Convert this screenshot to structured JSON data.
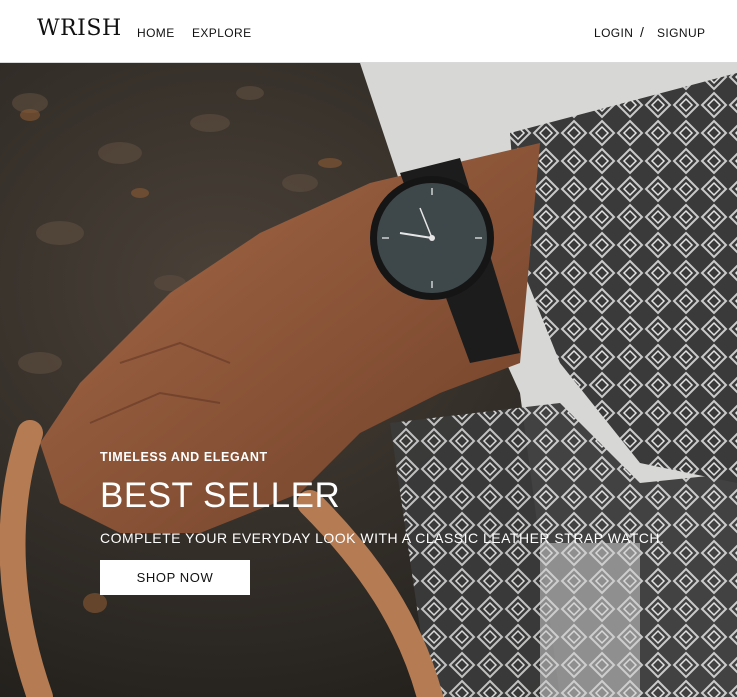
{
  "nav": {
    "logo": "WRISH",
    "links": [
      {
        "label": "HOME"
      },
      {
        "label": "EXPLORE"
      }
    ],
    "login": "LOGIN",
    "separator": "/",
    "signup": "SIGNUP"
  },
  "hero": {
    "eyebrow": "TIMELESS AND ELEGANT",
    "headline": "BEST SELLER",
    "subline": "COMPLETE YOUR EVERYDAY LOOK WITH A CLASSIC LEATHER STRAP WATCH.",
    "cta": "SHOP NOW"
  },
  "colors": {
    "nav_bg": "#ffffff",
    "text_dark": "#111111",
    "hero_text": "#ffffff",
    "button_bg": "#ffffff"
  }
}
